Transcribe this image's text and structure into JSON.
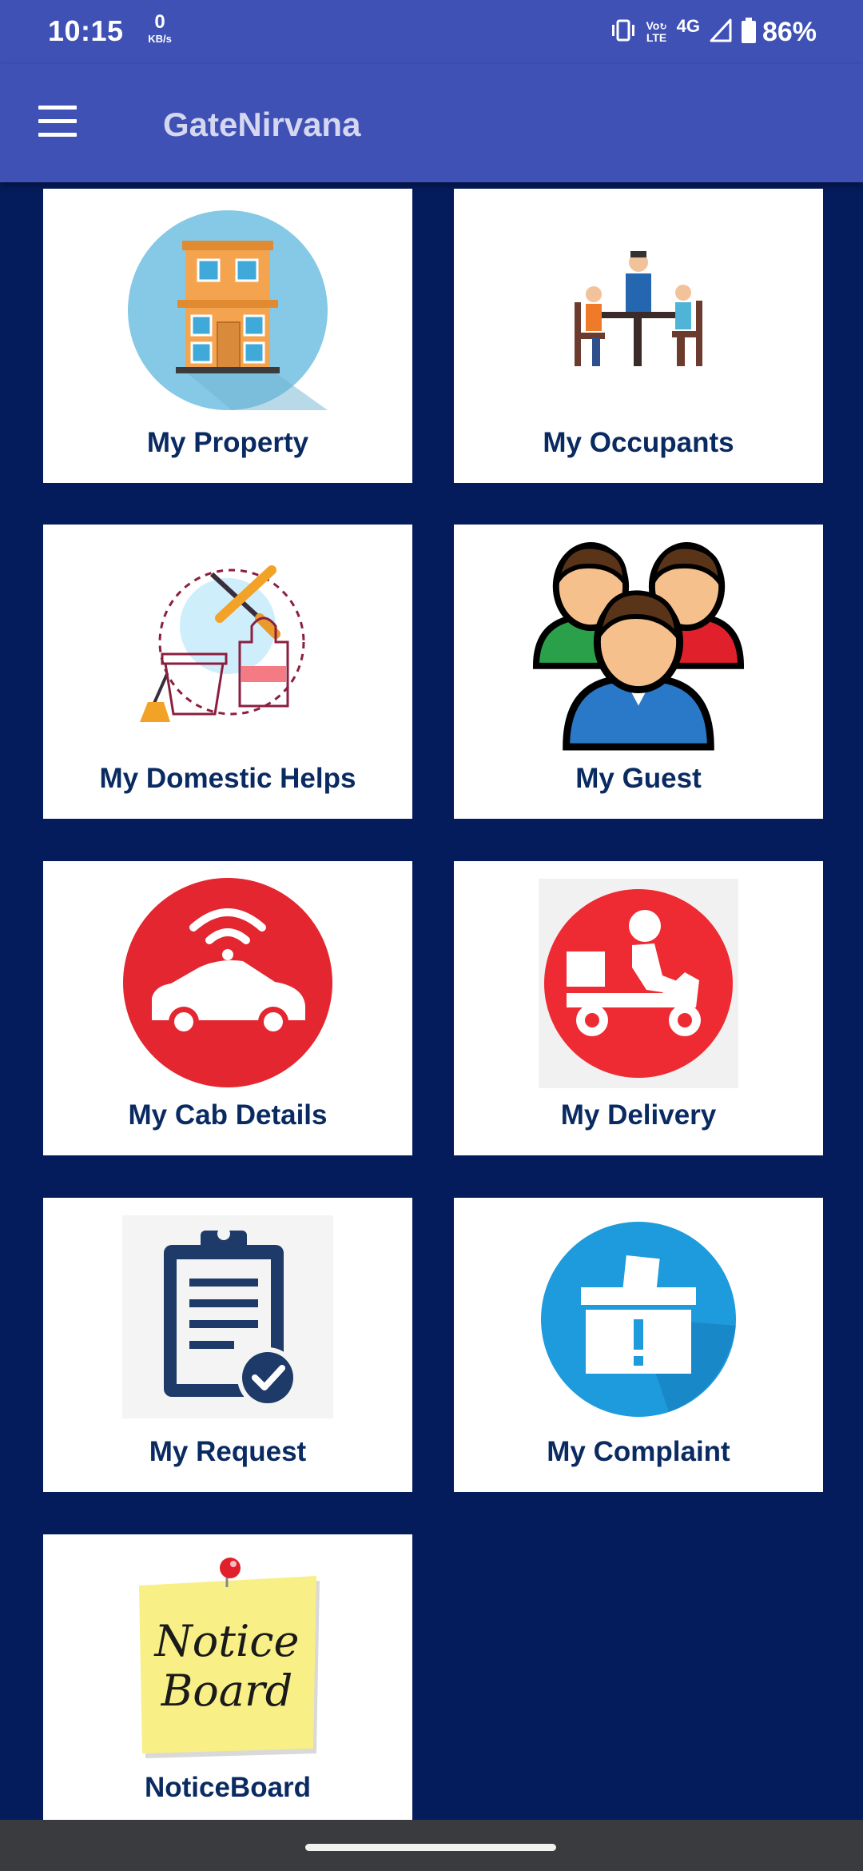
{
  "status": {
    "time": "10:15",
    "speed_value": "0",
    "speed_unit": "KB/s",
    "volte_top": "Vo",
    "volte_bottom": "LTE",
    "network": "4G",
    "battery": "86%"
  },
  "appbar": {
    "title": "GateNirvana",
    "menu_icon": "hamburger-menu-icon"
  },
  "tiles": [
    {
      "label": "My Property",
      "icon": "building-icon"
    },
    {
      "label": "My Occupants",
      "icon": "people-at-table-icon"
    },
    {
      "label": "My Domestic Helps",
      "icon": "cleaning-tools-icon"
    },
    {
      "label": "My Guest",
      "icon": "guests-group-icon"
    },
    {
      "label": "My Cab Details",
      "icon": "connected-car-icon"
    },
    {
      "label": "My Delivery",
      "icon": "delivery-scooter-icon"
    },
    {
      "label": "My Request",
      "icon": "clipboard-check-icon"
    },
    {
      "label": "My Complaint",
      "icon": "complaint-box-icon"
    },
    {
      "label": "NoticeBoard",
      "icon": "sticky-note-icon",
      "note_line1": "Notice",
      "note_line2": "Board"
    }
  ],
  "colors": {
    "appbar": "#3f51b5",
    "background": "#051c5c",
    "label": "#0a2a62",
    "tile": "#ffffff"
  }
}
